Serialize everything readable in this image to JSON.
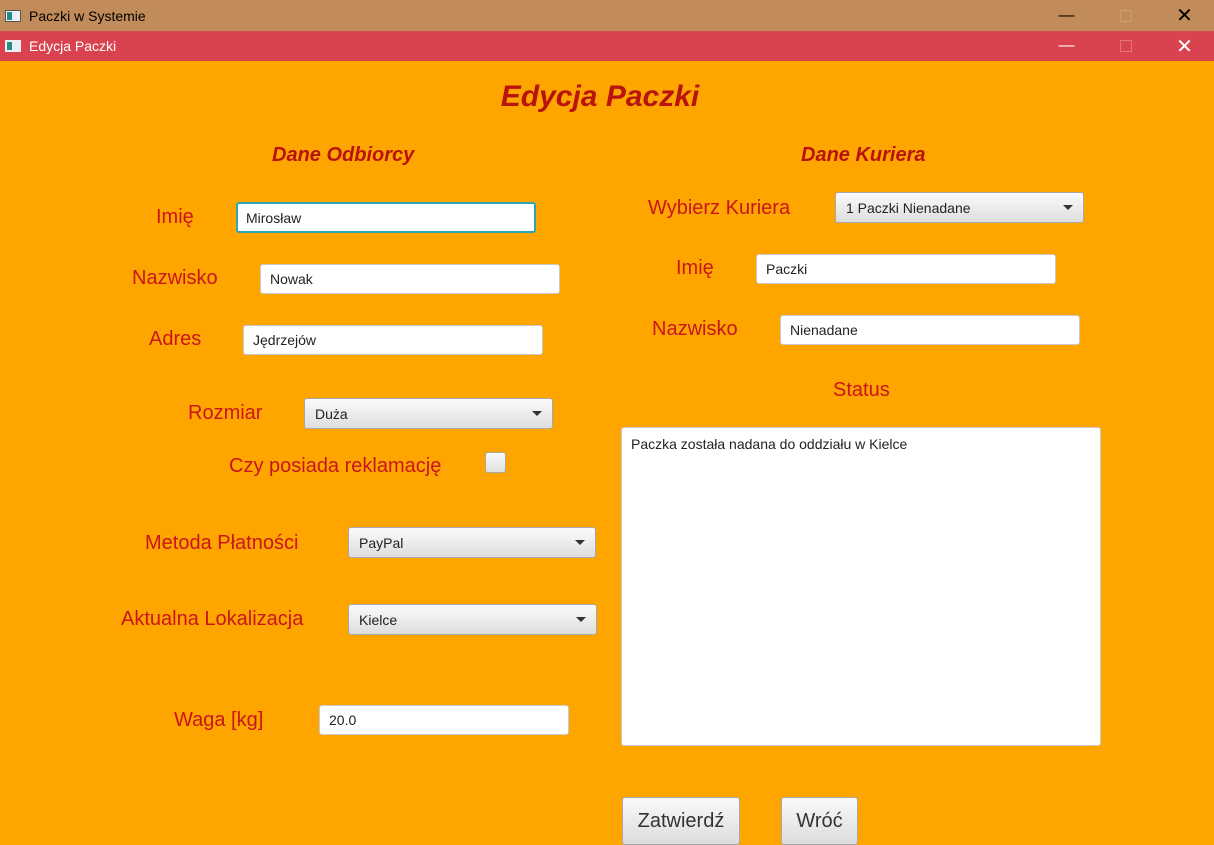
{
  "windows": {
    "outer_title": "Paczki w Systemie",
    "inner_title": "Edycja Paczki"
  },
  "titlebar_glyphs": {
    "minimize": "—",
    "close": "✕"
  },
  "page": {
    "title": "Edycja Paczki"
  },
  "recipient": {
    "heading": "Dane Odbiorcy",
    "first_name_label": "Imię",
    "first_name_value": "Mirosław",
    "last_name_label": "Nazwisko",
    "last_name_value": "Nowak",
    "address_label": "Adres",
    "address_value": "Jędrzejów",
    "size_label": "Rozmiar",
    "size_value": "Duża",
    "complaint_label": "Czy posiada reklamację",
    "complaint_checked": false,
    "payment_label": "Metoda Płatności",
    "payment_value": "PayPal",
    "location_label": "Aktualna Lokalizacja",
    "location_value": "Kielce",
    "weight_label": "Waga [kg]",
    "weight_value": "20.0"
  },
  "courier": {
    "heading": "Dane Kuriera",
    "select_label": "Wybierz Kuriera",
    "select_value": "1 Paczki Nienadane",
    "first_name_label": "Imię",
    "first_name_value": "Paczki",
    "last_name_label": "Nazwisko",
    "last_name_value": "Nienadane",
    "status_label": "Status",
    "status_value": "Paczka została nadana do oddziału w Kielce"
  },
  "actions": {
    "confirm_label": "Zatwierdź",
    "back_label": "Wróć"
  },
  "colors": {
    "background": "#ffa500",
    "outer_titlebar": "#c18c5a",
    "inner_titlebar": "#d8434f",
    "label_text": "#c8161c",
    "heading_text": "#b8130f",
    "focus_border": "#2aa6b6"
  }
}
